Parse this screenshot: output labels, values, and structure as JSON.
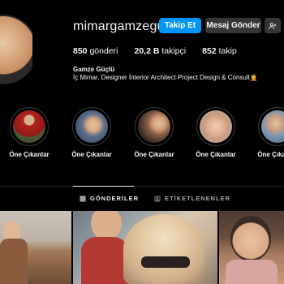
{
  "profile": {
    "username": "mimargamzeguclu",
    "follow_label": "Takip Et",
    "message_label": "Mesaj Gönder",
    "posts": "850",
    "posts_label": "gönderi",
    "followers": "20,2 B",
    "followers_label": "takipçi",
    "following": "852",
    "following_label": "takip",
    "full_name": "Gamze Güçlü",
    "bio": "İç Mimar, Designer İnterior Architect Project Design & Consult🤦"
  },
  "highlights": [
    {
      "label": "Öne Çıkanlar"
    },
    {
      "label": "Öne Çıkanlar"
    },
    {
      "label": "Öne Çıkanlar"
    },
    {
      "label": "Öne Çıkanlar"
    },
    {
      "label": "Öne Çıkanlar"
    }
  ],
  "tabs": {
    "posts_label": "GÖNDERİLER",
    "tagged_label": "ETİKETLENENLER"
  },
  "icons": {
    "suggest": "add-person-icon",
    "posts_tab": "grid-icon",
    "tagged_tab": "tagged-person-icon"
  },
  "colors": {
    "follow_button": "#0095f6",
    "secondary_button": "#363636",
    "background": "#000000",
    "muted_text": "#a8a8a8"
  }
}
